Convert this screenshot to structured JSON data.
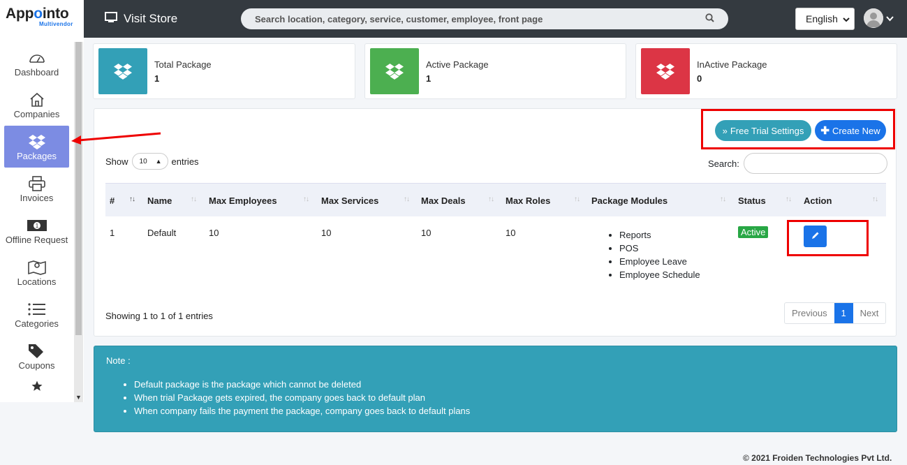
{
  "brand": {
    "name_pre": "App",
    "name_o": "o",
    "name_post": "into",
    "subtitle": "Multivendor"
  },
  "topbar": {
    "visit_store": "Visit Store",
    "search_placeholder": "Search location, category, service, customer, employee, front page",
    "language": "English"
  },
  "sidebar": {
    "items": [
      {
        "label": "Dashboard",
        "icon": "dashboard-icon"
      },
      {
        "label": "Companies",
        "icon": "home-icon"
      },
      {
        "label": "Packages",
        "icon": "dropbox-icon",
        "active": true
      },
      {
        "label": "Invoices",
        "icon": "printer-icon"
      },
      {
        "label": "Offline Request",
        "icon": "money-icon"
      },
      {
        "label": "Locations",
        "icon": "map-icon"
      },
      {
        "label": "Categories",
        "icon": "list-icon"
      },
      {
        "label": "Coupons",
        "icon": "tags-icon"
      }
    ]
  },
  "stats": [
    {
      "label": "Total Package",
      "value": "1",
      "color": "#33a0b7"
    },
    {
      "label": "Active Package",
      "value": "1",
      "color": "#4caf50"
    },
    {
      "label": "InActive Package",
      "value": "0",
      "color": "#dc3545"
    }
  ],
  "toolbar": {
    "free_trial": "Free Trial Settings",
    "create_new": "Create New"
  },
  "table_controls": {
    "show": "Show",
    "entries_value": "10",
    "entries": "entries",
    "search_label": "Search:"
  },
  "table": {
    "headers": [
      "#",
      "Name",
      "Max Employees",
      "Max Services",
      "Max Deals",
      "Max Roles",
      "Package Modules",
      "Status",
      "Action"
    ],
    "rows": [
      {
        "num": "1",
        "name": "Default",
        "max_employees": "10",
        "max_services": "10",
        "max_deals": "10",
        "max_roles": "10",
        "modules": [
          "Reports",
          "POS",
          "Employee Leave",
          "Employee Schedule"
        ],
        "status": "Active"
      }
    ]
  },
  "pagination": {
    "showing": "Showing 1 to 1 of 1 entries",
    "previous": "Previous",
    "current": "1",
    "next": "Next"
  },
  "note": {
    "title": "Note :",
    "items": [
      "Default package is the package which cannot be deleted",
      "When trial Package gets expired, the company goes back to default plan",
      "When company fails the payment the package, company goes back to default plans"
    ]
  },
  "footer": "© 2021 Froiden Technologies Pvt Ltd."
}
